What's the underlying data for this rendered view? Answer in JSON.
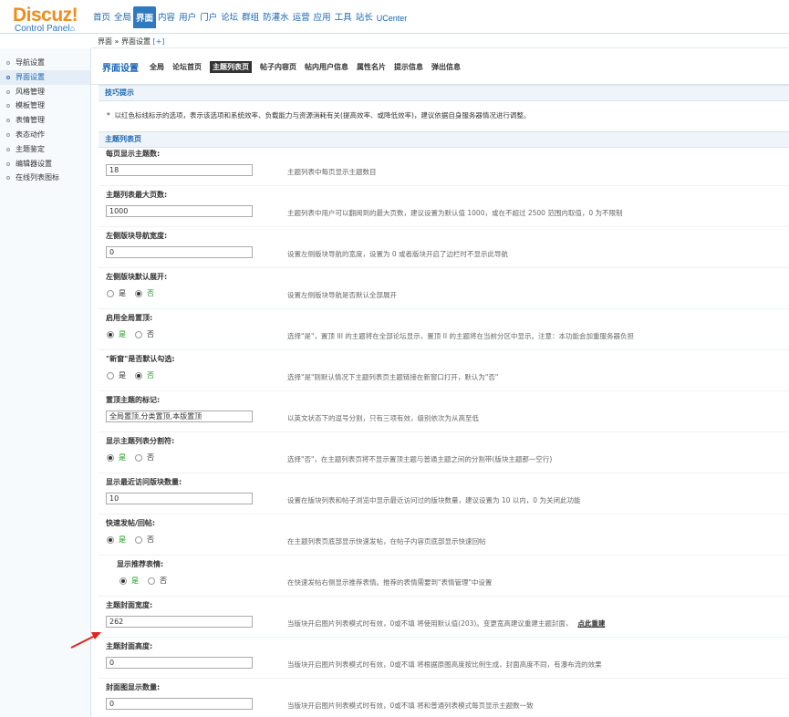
{
  "logo": {
    "title": "Discuz!",
    "subtitle": "Control Panel"
  },
  "topnav": [
    "首页",
    "全局",
    "界面",
    "内容",
    "用户",
    "门户",
    "论坛",
    "群组",
    "防灌水",
    "运营",
    "应用",
    "工具",
    "站长",
    "UCenter"
  ],
  "breadcrumb": {
    "text": "界面 » 界面设置",
    "add": "[+]"
  },
  "sidebar": [
    "导航设置",
    "界面设置",
    "风格管理",
    "模板管理",
    "表情管理",
    "表态动作",
    "主题鉴定",
    "编辑器设置",
    "在线列表图标"
  ],
  "page": {
    "title": "界面设置",
    "tabs": [
      "全局",
      "论坛首页",
      "主题列表页",
      "帖子内容页",
      "帖内用户信息",
      "属性名片",
      "提示信息",
      "弹出信息"
    ],
    "active_tab": "主题列表页"
  },
  "tips": {
    "title": "技巧提示",
    "bullet": "*",
    "text": "以红色标线标示的选项，表示该选项和系统效率、负载能力与资源消耗有关(提高效率、或降低效率)，建议依据自身服务器情况进行调整。"
  },
  "section": {
    "title": "主题列表页"
  },
  "radio_labels": {
    "yes": "是",
    "no": "否"
  },
  "settings": [
    {
      "label": "每页显示主题数:",
      "type": "text",
      "value": "18",
      "desc": "主题列表中每页显示主题数目"
    },
    {
      "label": "主题列表最大页数:",
      "type": "text",
      "value": "1000",
      "desc": "主题列表中用户可以翻阅到的最大页数，建议设置为默认值 1000，或在不超过 2500 范围内取值，0 为不限制"
    },
    {
      "label": "左侧版块导航宽度:",
      "type": "text",
      "value": "0",
      "desc": "设置左侧版块导航的宽度，设置为 0 或者版块开启了边栏时不显示此导航"
    },
    {
      "label": "左侧版块默认展开:",
      "type": "radio",
      "value": "否",
      "desc": "设置左侧版块导航是否默认全部展开"
    },
    {
      "label": "启用全局置顶:",
      "type": "radio",
      "value": "是",
      "desc": "选择\"是\"，置顶 III 的主题将在全部论坛显示，置顶 II 的主题将在当前分区中显示。注意：本功能会加重服务器负担"
    },
    {
      "label": "\"新窗\"是否默认勾选:",
      "type": "radio",
      "value": "否",
      "desc": "选择\"是\"则默认情况下主题列表页主题链接在新窗口打开，默认为\"否\""
    },
    {
      "label": "置顶主题的标记:",
      "type": "text",
      "value": "全局置顶,分类置顶,本版置顶",
      "desc": "以英文状态下的逗号分割，只有三项有效，级别依次为从高至低"
    },
    {
      "label": "显示主题列表分割符:",
      "type": "radio",
      "value": "是",
      "desc": "选择\"否\"，在主题列表页将不显示置顶主题与普通主题之间的分割带(版块主题那一空行)"
    },
    {
      "label": "显示最近访问版块数量:",
      "type": "text",
      "value": "10",
      "desc": "设置在版块列表和帖子浏览中显示最近访问过的版块数量，建议设置为 10 以内，0 为关闭此功能"
    },
    {
      "label": "快速发帖/回帖:",
      "type": "radio",
      "value": "是",
      "desc": "在主题列表页底部显示快速发帖，在帖子内容页底部显示快速回帖"
    },
    {
      "label": "显示推荐表情:",
      "type": "radio",
      "value": "是",
      "sub": true,
      "desc": "在快速发帖右侧显示推荐表情。推荐的表情需要到\"表情管理\"中设置"
    },
    {
      "label": "主题封面宽度:",
      "type": "text",
      "value": "262",
      "desc": "当版块开启图片列表模式时有效，0或不填 将使用默认值(203)。变更宽高建议重建主题封面，",
      "link": "点此重建"
    },
    {
      "label": "主题封面高度:",
      "type": "text",
      "value": "0",
      "desc": "当版块开启图片列表模式时有效，0或不填 将根据原图高度按比例生成，封面高度不同，有瀑布流的效果"
    },
    {
      "label": "封面图显示数量:",
      "type": "text",
      "value": "0",
      "desc": "当版块开启图片列表模式时有效，0或不填 将和普通列表模式每页显示主题数一致"
    }
  ],
  "colors": {
    "accent": "#2f7abf",
    "logo": "#f28b1a",
    "selected": "#1a9a1a",
    "annotation": "#e0241b"
  }
}
